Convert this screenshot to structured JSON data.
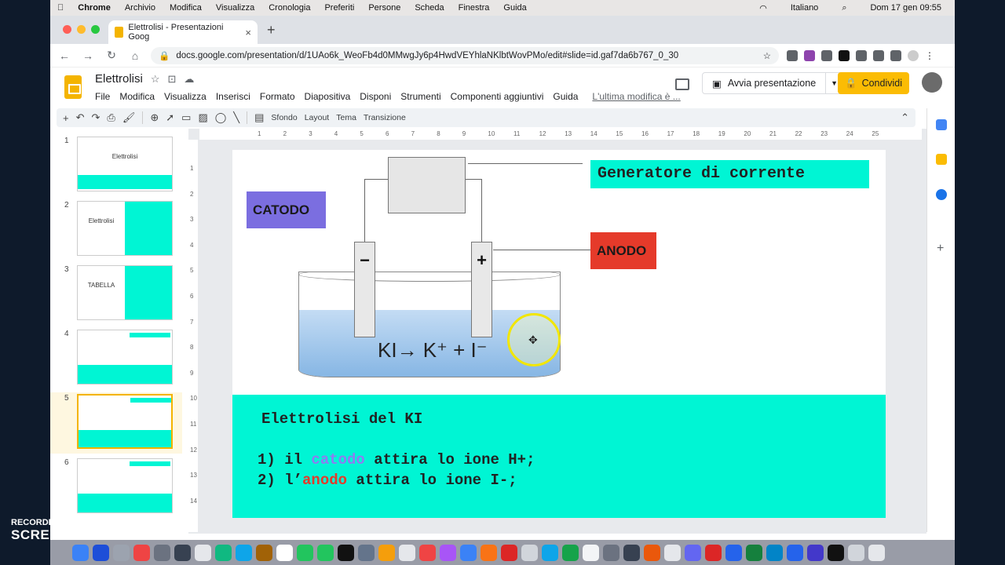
{
  "mac_menubar": {
    "app": "Chrome",
    "items": [
      "Archivio",
      "Modifica",
      "Visualizza",
      "Cronologia",
      "Preferiti",
      "Persone",
      "Scheda",
      "Finestra",
      "Guida"
    ],
    "language": "Italiano",
    "datetime": "Dom 17 gen  09:55"
  },
  "browser": {
    "tab_title": "Elettrolisi - Presentazioni Goog",
    "url": "docs.google.com/presentation/d/1UAo6k_WeoFb4d0MMwgJy6p4HwdVEYhlaNKlbtWovPMo/edit#slide=id.gaf7da6b767_0_30"
  },
  "app": {
    "doc_title": "Elettrolisi",
    "menus": [
      "File",
      "Modifica",
      "Visualizza",
      "Inserisci",
      "Formato",
      "Diapositiva",
      "Disponi",
      "Strumenti",
      "Componenti aggiuntivi",
      "Guida"
    ],
    "last_edit": "L'ultima modifica è ...",
    "present_label": "Avvia presentazione",
    "share_label": "Condividi"
  },
  "toolbar": {
    "background": "Sfondo",
    "layout": "Layout",
    "theme": "Tema",
    "transition": "Transizione"
  },
  "thumbnails": [
    {
      "num": "1",
      "title": "Elettrolisi"
    },
    {
      "num": "2",
      "title": "Elettrolisi"
    },
    {
      "num": "3",
      "title": "TABELLA"
    },
    {
      "num": "4",
      "title": ""
    },
    {
      "num": "5",
      "title": ""
    },
    {
      "num": "6",
      "title": ""
    }
  ],
  "ruler": [
    "1",
    "2",
    "3",
    "4",
    "5",
    "6",
    "7",
    "8",
    "9",
    "10",
    "11",
    "12",
    "13",
    "14",
    "15",
    "16",
    "17",
    "18",
    "19",
    "20",
    "21",
    "22",
    "23",
    "24",
    "25"
  ],
  "vruler": [
    "1",
    "2",
    "3",
    "4",
    "5",
    "6",
    "7",
    "8",
    "9",
    "10",
    "11",
    "12",
    "13",
    "14"
  ],
  "slide": {
    "generator_label": "Generatore di corrente",
    "cathode_label": "CATODO",
    "anode_label": "ANODO",
    "minus": "−",
    "plus": "+",
    "reaction": "KI→ K⁺ + I⁻",
    "heading": "Elettrolisi del KI",
    "line1_prefix": "1)  il ",
    "line1_colored": "catodo",
    "line1_suffix": " attira lo ione H+;",
    "line2_prefix": "2)  l’",
    "line2_colored": "anodo",
    "line2_suffix": " attira  lo ione I-;"
  },
  "screencast": {
    "line1": "RECORDED WITH",
    "line2": "SCREENCAST  MATIC"
  },
  "colors": {
    "accent_cyan": "#00f5d4",
    "cathode": "#7b6ee0",
    "anode": "#e53a2a",
    "share": "#fbbc04"
  }
}
